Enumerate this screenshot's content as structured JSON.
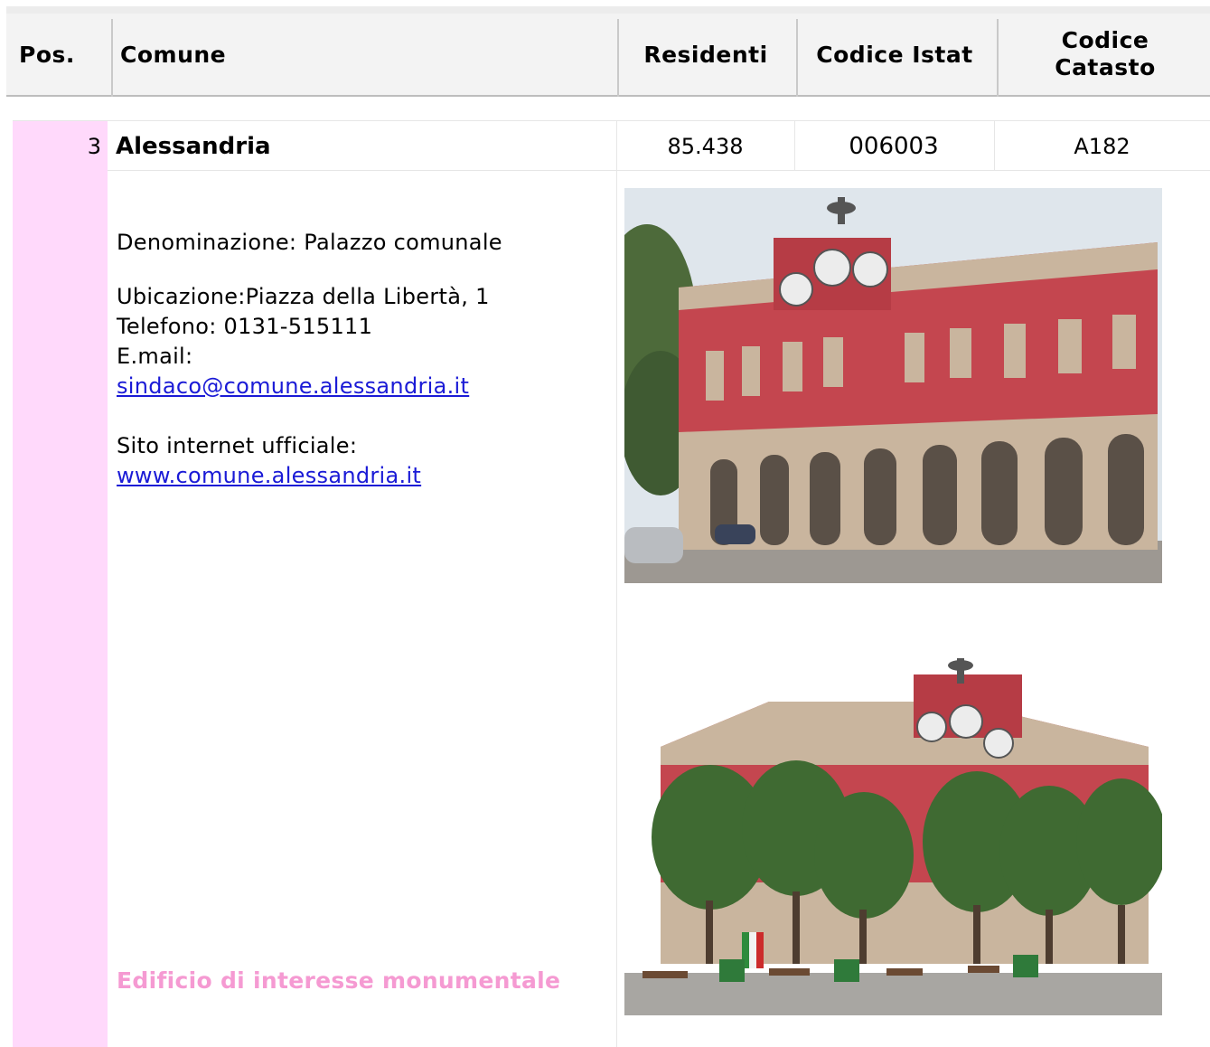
{
  "header": {
    "pos": "Pos.",
    "comune": "Comune",
    "residenti": "Residenti",
    "codice_istat": "Codice Istat",
    "codice_catasto_line1": "Codice",
    "codice_catasto_line2": "Catasto"
  },
  "row": {
    "pos": "3",
    "comune": "Alessandria",
    "residenti": "85.438",
    "codice_istat": "006003",
    "codice_catasto": "A182"
  },
  "details": {
    "denominazione": "Denominazione: Palazzo comunale",
    "ubicazione": "Ubicazione:Piazza della Libertà, 1",
    "telefono": "Telefono: 0131-515111",
    "email_label": "E.mail:",
    "email": "sindaco@comune.alessandria.it",
    "sito_label": "Sito internet ufficiale:",
    "sito": "www.comune.alessandria.it",
    "note": "Edificio di interesse monumentale"
  },
  "colors": {
    "pink_column": "#ffd9fb",
    "note_text": "#f59ad2",
    "link": "#1a1ad6",
    "facade": "#c4464f",
    "stone": "#c9b59e"
  }
}
